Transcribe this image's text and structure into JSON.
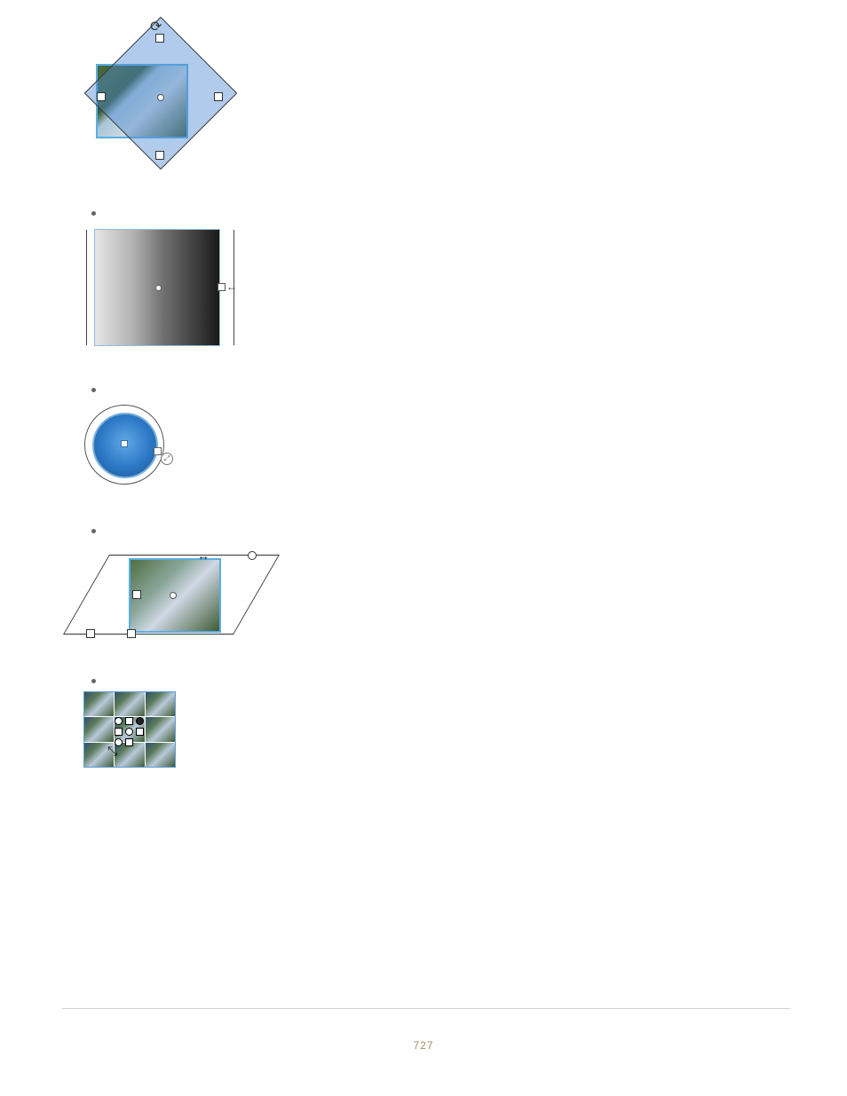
{
  "bullets": {
    "b1": "",
    "b2": "",
    "b3": "",
    "b4": ""
  },
  "page_number": "727"
}
